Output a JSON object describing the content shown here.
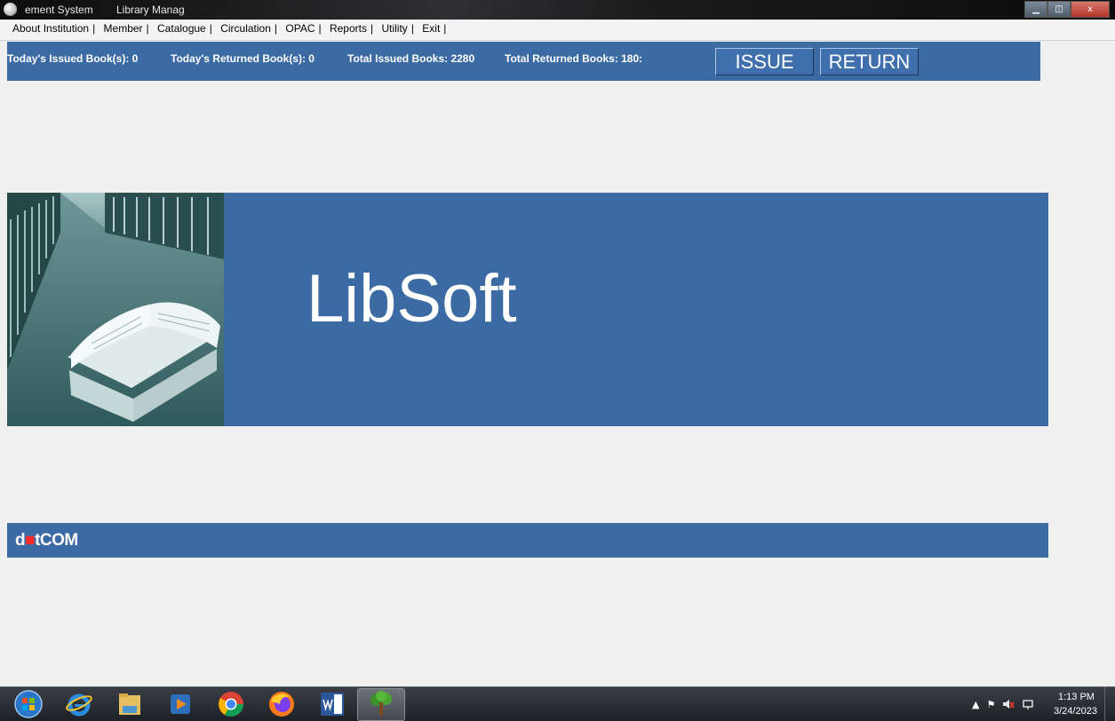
{
  "window": {
    "title_part1": "ement System",
    "title_part2": "Library Manag",
    "minimize_glyph": "▁",
    "maximize_glyph": "◫",
    "close_glyph": "x"
  },
  "menu": [
    {
      "label": "About Institution"
    },
    {
      "label": "Member"
    },
    {
      "label": "Catalogue"
    },
    {
      "label": "Circulation"
    },
    {
      "label": "OPAC"
    },
    {
      "label": "Reports"
    },
    {
      "label": "Utility"
    },
    {
      "label": "Exit"
    }
  ],
  "menu_separator": "|",
  "stats": {
    "today_issued": "Today's Issued Book(s): 0",
    "today_returned": "Today's Returned Book(s): 0",
    "total_issued": "Total Issued Books: 2280",
    "total_returned": "Total Returned Books: 180:"
  },
  "buttons": {
    "issue": "ISSUE",
    "return": "RETURN"
  },
  "banner": {
    "brand_name": "LibSoft"
  },
  "footer": {
    "logo_d": "d",
    "logo_dot": "■",
    "logo_rest": "tCOM"
  },
  "taskbar": {
    "icons": [
      "start-orb-icon",
      "internet-explorer-icon",
      "file-explorer-icon",
      "media-player-icon",
      "chrome-icon",
      "firefox-icon",
      "word-icon",
      "libsoft-tree-icon"
    ],
    "tray": {
      "arrow": "▲",
      "flag": "⚑"
    },
    "clock_time": "1:13 PM",
    "clock_date": "3/24/2023"
  },
  "colors": {
    "panel_blue": "#3c6aa3",
    "window_bg": "#f0f0f0",
    "logo_dot_red": "#ff2a2a"
  }
}
